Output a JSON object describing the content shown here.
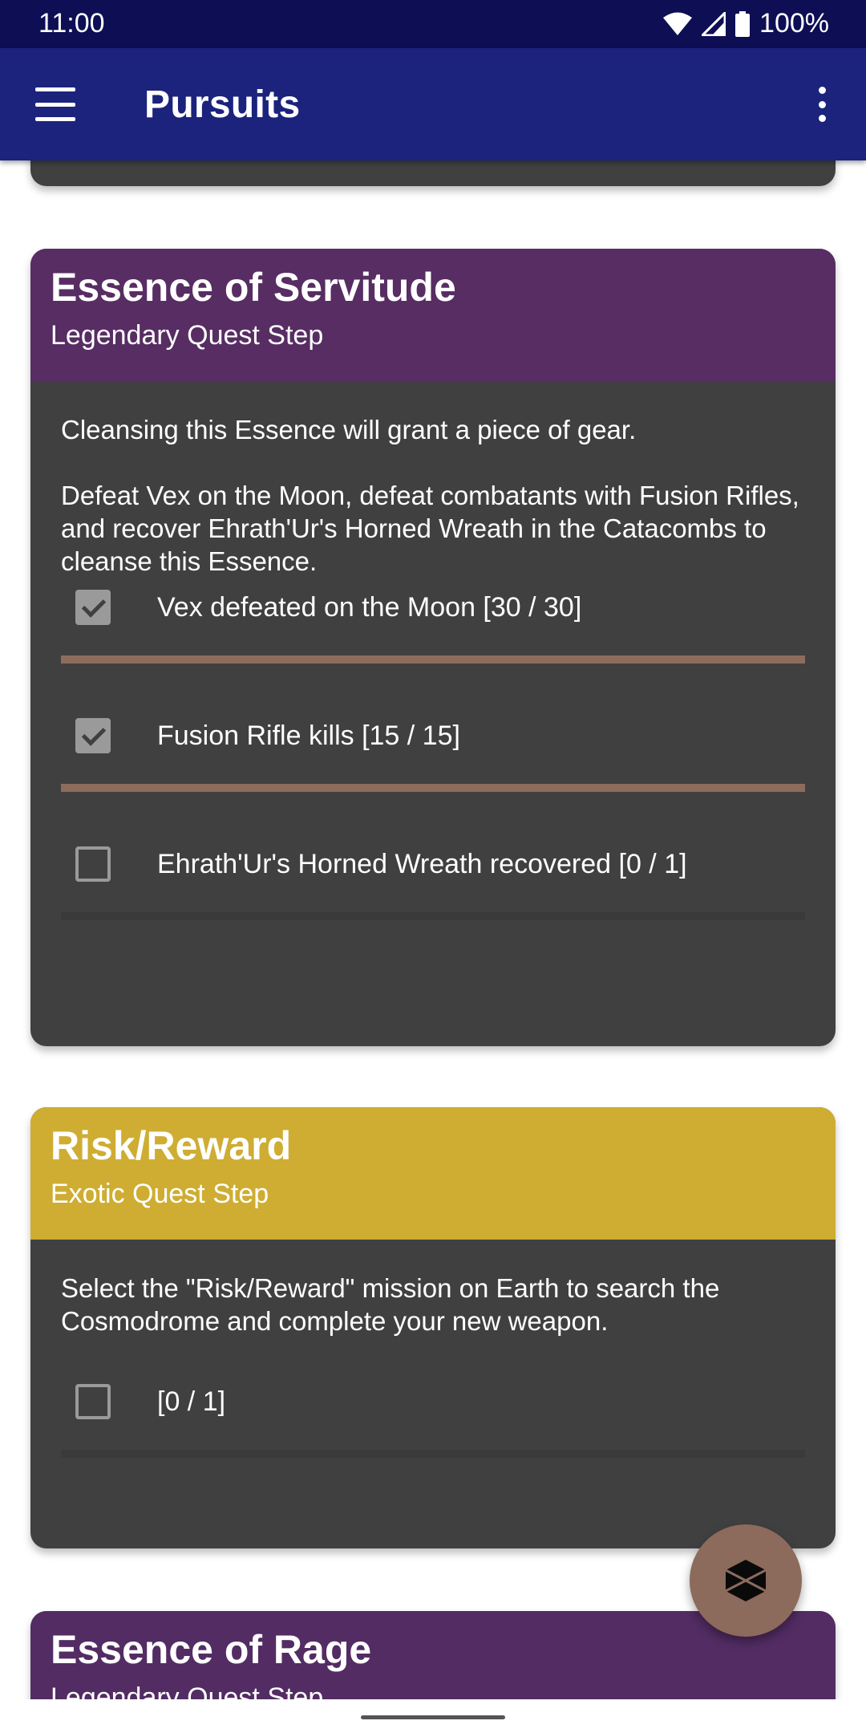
{
  "status": {
    "time": "11:00",
    "battery": "100%"
  },
  "app_bar": {
    "title": "Pursuits"
  },
  "cards": [
    {
      "title": "Essence of Servitude",
      "subtitle": "Legendary Quest Step",
      "header_color": "#572d63",
      "description": "Cleansing this Essence will grant a piece of gear.\n\nDefeat Vex on the Moon, defeat combatants with Fusion Rifles, and recover Ehrath'Ur's Horned Wreath in the Catacombs to cleanse this Essence.",
      "objectives": [
        {
          "label": "Vex defeated on the Moon [30 / 30]",
          "checked": true,
          "progress": 1.0
        },
        {
          "label": "Fusion Rifle kills [15 / 15]",
          "checked": true,
          "progress": 1.0
        },
        {
          "label": "Ehrath'Ur's Horned Wreath recovered [0 / 1]",
          "checked": false,
          "progress": 0
        }
      ]
    },
    {
      "title": "Risk/Reward",
      "subtitle": "Exotic Quest Step",
      "header_color": "#cead32",
      "description": "Select the \"Risk/Reward\" mission on Earth to search the Cosmodrome and complete your new weapon.",
      "objectives": [
        {
          "label": " [0 / 1]",
          "checked": false,
          "progress": 0
        }
      ]
    },
    {
      "title": "Essence of Rage",
      "subtitle": "Legendary Quest Step",
      "header_color": "#522c63"
    }
  ],
  "colors": {
    "status_bar": "#0e0e55",
    "app_bar": "#1b237c",
    "card_body": "#404040",
    "progress_fill": "#8e6c5c",
    "fab": "#8c6a5c"
  },
  "icons": {
    "menu": "hamburger-menu-icon",
    "overflow": "more-vert-icon",
    "fab": "cube-icon"
  }
}
